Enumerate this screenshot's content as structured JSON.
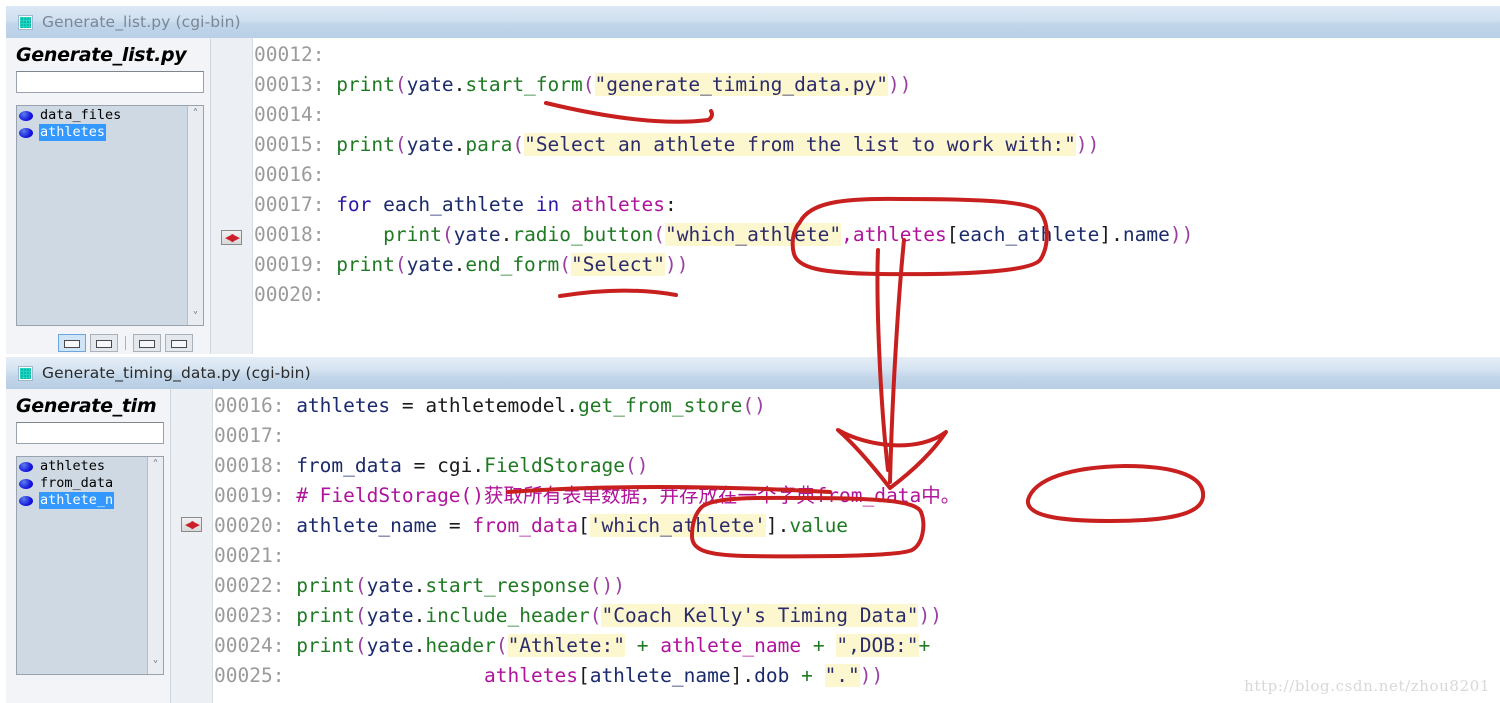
{
  "watermark": "http://blog.csdn.net/zhou8201",
  "windows": [
    {
      "title": "Generate_list.py (cgi-bin)",
      "icon": "python-file-icon",
      "sidebar": {
        "heading": "Generate_list.py",
        "search_value": "",
        "search_placeholder": "",
        "items": [
          {
            "label": "data_files",
            "selected": false
          },
          {
            "label": "athletes",
            "selected": true
          }
        ],
        "scroll_up": "˄",
        "scroll_down": "˅"
      },
      "marker_line_index": 6,
      "marker_glyph": "◀▶",
      "lines": [
        {
          "num": "00012:",
          "tokens": []
        },
        {
          "num": "00013:",
          "tokens": [
            {
              "t": "print",
              "c": "fn"
            },
            {
              "t": "(",
              "c": "punc"
            },
            {
              "t": "yate",
              "c": "ident"
            },
            {
              "t": ".",
              "c": "plain"
            },
            {
              "t": "start_form",
              "c": "fn"
            },
            {
              "t": "(",
              "c": "punc"
            },
            {
              "t": "\"generate_timing_data.py\"",
              "c": "str"
            },
            {
              "t": "))",
              "c": "punc"
            }
          ]
        },
        {
          "num": "00014:",
          "tokens": []
        },
        {
          "num": "00015:",
          "tokens": [
            {
              "t": "print",
              "c": "fn"
            },
            {
              "t": "(",
              "c": "punc"
            },
            {
              "t": "yate",
              "c": "ident"
            },
            {
              "t": ".",
              "c": "plain"
            },
            {
              "t": "para",
              "c": "fn"
            },
            {
              "t": "(",
              "c": "punc"
            },
            {
              "t": "\"Select an athlete from the list to work with:\"",
              "c": "str"
            },
            {
              "t": "))",
              "c": "punc"
            }
          ]
        },
        {
          "num": "00016:",
          "tokens": []
        },
        {
          "num": "00017:",
          "tokens": [
            {
              "t": "for",
              "c": "kw"
            },
            {
              "t": " each_athlete ",
              "c": "ident"
            },
            {
              "t": "in",
              "c": "kw"
            },
            {
              "t": " ",
              "c": "plain"
            },
            {
              "t": "athletes",
              "c": "mag"
            },
            {
              "t": ":",
              "c": "plain"
            }
          ]
        },
        {
          "num": "00018:",
          "tokens": [
            {
              "t": "    ",
              "c": "plain"
            },
            {
              "t": "print",
              "c": "fn"
            },
            {
              "t": "(",
              "c": "punc"
            },
            {
              "t": "yate",
              "c": "ident"
            },
            {
              "t": ".",
              "c": "plain"
            },
            {
              "t": "radio_button",
              "c": "fn"
            },
            {
              "t": "(",
              "c": "punc"
            },
            {
              "t": "\"which_athlete\"",
              "c": "str"
            },
            {
              "t": ",",
              "c": "mag"
            },
            {
              "t": "athletes",
              "c": "mag"
            },
            {
              "t": "[",
              "c": "plain"
            },
            {
              "t": "each_athlete",
              "c": "ident"
            },
            {
              "t": "]",
              "c": "plain"
            },
            {
              "t": ".",
              "c": "plain"
            },
            {
              "t": "name",
              "c": "ident"
            },
            {
              "t": "))",
              "c": "punc"
            }
          ]
        },
        {
          "num": "00019:",
          "tokens": [
            {
              "t": "print",
              "c": "fn"
            },
            {
              "t": "(",
              "c": "punc"
            },
            {
              "t": "yate",
              "c": "ident"
            },
            {
              "t": ".",
              "c": "plain"
            },
            {
              "t": "end_form",
              "c": "fn"
            },
            {
              "t": "(",
              "c": "punc"
            },
            {
              "t": "\"Select\"",
              "c": "str"
            },
            {
              "t": "))",
              "c": "punc"
            }
          ]
        },
        {
          "num": "00020:",
          "tokens": []
        }
      ]
    },
    {
      "title": "Generate_timing_data.py (cgi-bin)",
      "icon": "python-file-icon",
      "sidebar": {
        "heading": "Generate_tim",
        "search_value": "",
        "search_placeholder": "",
        "items": [
          {
            "label": "athletes",
            "selected": false
          },
          {
            "label": "from_data",
            "selected": false
          },
          {
            "label": "athlete_n",
            "selected": true
          }
        ],
        "scroll_up": "˄",
        "scroll_down": "˅"
      },
      "marker_line_index": 4,
      "marker_glyph": "◀▶",
      "lines": [
        {
          "num": "00016:",
          "tokens": [
            {
              "t": "athletes",
              "c": "var"
            },
            {
              "t": " = ",
              "c": "plain"
            },
            {
              "t": "athletemodel",
              "c": "plain"
            },
            {
              "t": ".",
              "c": "plain"
            },
            {
              "t": "get_from_store",
              "c": "fn"
            },
            {
              "t": "()",
              "c": "punc"
            }
          ]
        },
        {
          "num": "00017:",
          "tokens": []
        },
        {
          "num": "00018:",
          "tokens": [
            {
              "t": "from_data",
              "c": "var"
            },
            {
              "t": " = ",
              "c": "plain"
            },
            {
              "t": "cgi",
              "c": "plain"
            },
            {
              "t": ".",
              "c": "plain"
            },
            {
              "t": "FieldStorage",
              "c": "fn"
            },
            {
              "t": "()",
              "c": "punc"
            }
          ]
        },
        {
          "num": "00019:",
          "tokens": [
            {
              "t": "# FieldStorage()获取所有表单数据，并存放在一个字典from_data中。",
              "c": "cmt"
            }
          ]
        },
        {
          "num": "00020:",
          "tokens": [
            {
              "t": "athlete_name",
              "c": "var"
            },
            {
              "t": " = ",
              "c": "plain"
            },
            {
              "t": "from_data",
              "c": "mag"
            },
            {
              "t": "[",
              "c": "plain"
            },
            {
              "t": "'which_athlete'",
              "c": "str"
            },
            {
              "t": "]",
              "c": "plain"
            },
            {
              "t": ".",
              "c": "plain"
            },
            {
              "t": "value",
              "c": "fn"
            }
          ]
        },
        {
          "num": "00021:",
          "tokens": []
        },
        {
          "num": "00022:",
          "tokens": [
            {
              "t": "print",
              "c": "fn"
            },
            {
              "t": "(",
              "c": "punc"
            },
            {
              "t": "yate",
              "c": "ident"
            },
            {
              "t": ".",
              "c": "plain"
            },
            {
              "t": "start_response",
              "c": "fn"
            },
            {
              "t": "())",
              "c": "punc"
            }
          ]
        },
        {
          "num": "00023:",
          "tokens": [
            {
              "t": "print",
              "c": "fn"
            },
            {
              "t": "(",
              "c": "punc"
            },
            {
              "t": "yate",
              "c": "ident"
            },
            {
              "t": ".",
              "c": "plain"
            },
            {
              "t": "include_header",
              "c": "fn"
            },
            {
              "t": "(",
              "c": "punc"
            },
            {
              "t": "\"Coach Kelly's Timing Data\"",
              "c": "str"
            },
            {
              "t": "))",
              "c": "punc"
            }
          ]
        },
        {
          "num": "00024:",
          "tokens": [
            {
              "t": "print",
              "c": "fn"
            },
            {
              "t": "(",
              "c": "punc"
            },
            {
              "t": "yate",
              "c": "ident"
            },
            {
              "t": ".",
              "c": "plain"
            },
            {
              "t": "header",
              "c": "fn"
            },
            {
              "t": "(",
              "c": "punc"
            },
            {
              "t": "\"Athlete:\"",
              "c": "str"
            },
            {
              "t": " + ",
              "c": "op"
            },
            {
              "t": "athlete_name",
              "c": "mag"
            },
            {
              "t": " + ",
              "c": "op"
            },
            {
              "t": "\",DOB:\"",
              "c": "str"
            },
            {
              "t": "+",
              "c": "op"
            }
          ]
        },
        {
          "num": "00025:",
          "tokens": [
            {
              "t": "                ",
              "c": "plain"
            },
            {
              "t": "athletes",
              "c": "mag"
            },
            {
              "t": "[",
              "c": "plain"
            },
            {
              "t": "athlete_name",
              "c": "ident"
            },
            {
              "t": "]",
              "c": "plain"
            },
            {
              "t": ".",
              "c": "plain"
            },
            {
              "t": "dob",
              "c": "ident"
            },
            {
              "t": " + ",
              "c": "op"
            },
            {
              "t": "\".\"",
              "c": "str"
            },
            {
              "t": "))",
              "c": "punc"
            }
          ]
        }
      ]
    }
  ],
  "annotations": {
    "color": "#c8201f",
    "shapes": [
      "underline-start-form",
      "underline-end-form",
      "oval-which-athlete-top",
      "arrow-down-to-line20",
      "oval-which-athlete-bottom",
      "oval-from-data",
      "strike-comment-line19"
    ]
  }
}
